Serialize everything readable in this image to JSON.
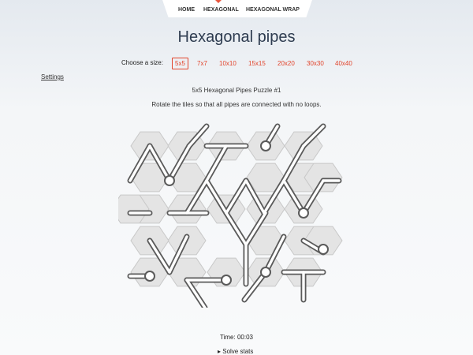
{
  "nav": {
    "home": "HOME",
    "hexagonal": "HEXAGONAL",
    "hexagonal_wrap": "HEXAGONAL WRAP"
  },
  "page": {
    "title": "Hexagonal pipes",
    "choose_size_label": "Choose a size:",
    "sizes": [
      "5x5",
      "7x7",
      "10x10",
      "15x15",
      "20x20",
      "30x30",
      "40x40"
    ],
    "selected_size": "5x5",
    "settings": "Settings",
    "puzzle_title": "5x5 Hexagonal Pipes Puzzle #1",
    "instructions": "Rotate the tiles so that all pipes are connected with no loops.",
    "timer": "Time: 00:03",
    "solve_stats": "▸ Solve stats"
  },
  "colors": {
    "accent": "#e2432a",
    "tile_fill": "#e4e4e4",
    "tile_border": "#c8c8c8",
    "pipe_outline": "#5a5a5a",
    "pipe_fill": "#ffffff",
    "title": "#2e3c50"
  },
  "icons": {
    "nav_marker": "active-nav-marker-icon",
    "solve_stats": "disclosure-triangle-icon"
  },
  "board": {
    "rows": 5,
    "cols": 5,
    "layout": "hexagonal"
  }
}
